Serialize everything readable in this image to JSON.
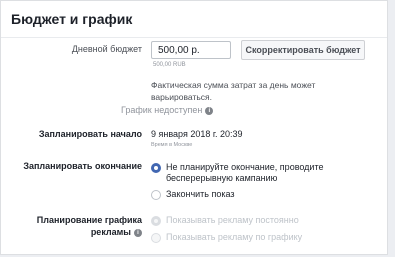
{
  "header": {
    "title": "Бюджет и график"
  },
  "budget": {
    "label": "Дневной бюджет",
    "value": "500,00 р.",
    "currency": "500,00 RUB",
    "adjust_button": "Скорректировать бюджет",
    "note": "Фактическая сумма затрат за день может варьироваться."
  },
  "schedule_unavailable": "График недоступен",
  "start": {
    "label": "Запланировать начало",
    "datetime": "9 января 2018 г. 20:39",
    "timezone": "Время в Москве"
  },
  "end": {
    "label": "Запланировать окончание",
    "options": [
      {
        "label": "Не планируйте окончание, проводите бесперерывную кампанию",
        "checked": true,
        "disabled": false
      },
      {
        "label": "Закончить показ",
        "checked": false,
        "disabled": false
      }
    ]
  },
  "ad_scheduling": {
    "label": "Планирование графика рекламы",
    "options": [
      {
        "label": "Показывать рекламу постоянно",
        "checked": true,
        "disabled": true
      },
      {
        "label": "Показывать рекламу по графику",
        "checked": false,
        "disabled": true
      }
    ]
  },
  "icons": {
    "info": "info-icon"
  },
  "colors": {
    "accent": "#4267b2",
    "muted": "#90949c"
  }
}
